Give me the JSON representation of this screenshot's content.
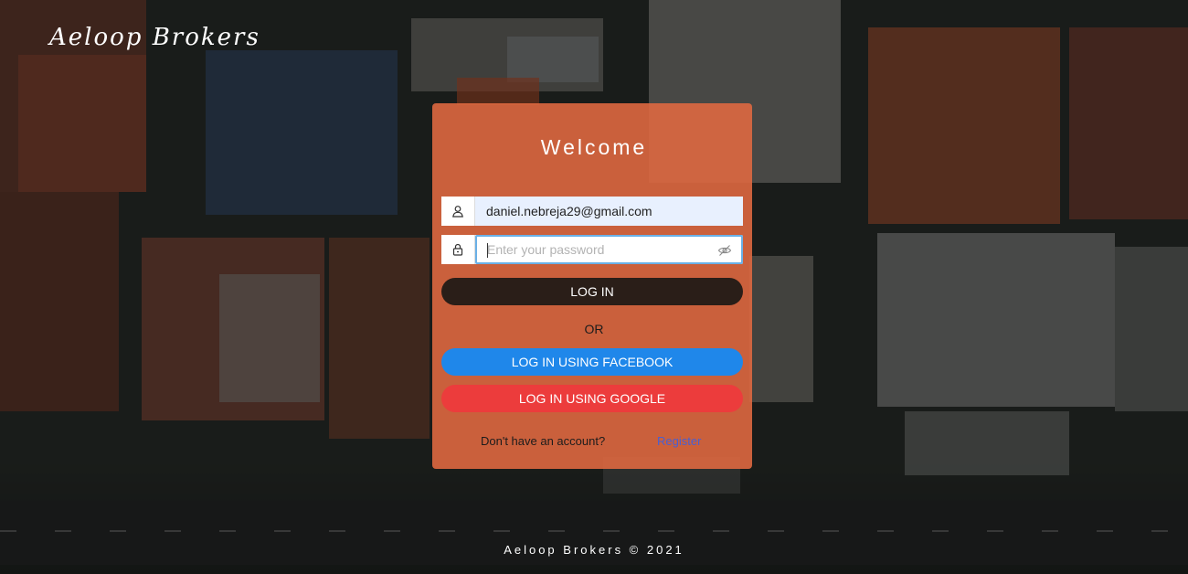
{
  "brand": {
    "name": "Aeloop Brokers"
  },
  "login_card": {
    "title": "Welcome",
    "email_field": {
      "value": "daniel.nebreja29@gmail.com",
      "icon": "user-icon"
    },
    "password_field": {
      "placeholder": "Enter your password",
      "value": "",
      "icon": "lock-icon",
      "toggle_icon": "eye-slash-icon"
    },
    "login_button": "LOG IN",
    "divider_text": "OR",
    "facebook_button": "LOG IN USING FACEBOOK",
    "google_button": "LOG IN USING GOOGLE",
    "no_account_text": "Don't have an account?",
    "register_link": "Register"
  },
  "footer": {
    "text": "Aeloop Brokers © 2021"
  },
  "colors": {
    "card": "#de6840",
    "login_button": "#2a1e18",
    "facebook_button": "#1f87ea",
    "google_button": "#ec3c3c",
    "register_link": "#4a5fd0"
  }
}
